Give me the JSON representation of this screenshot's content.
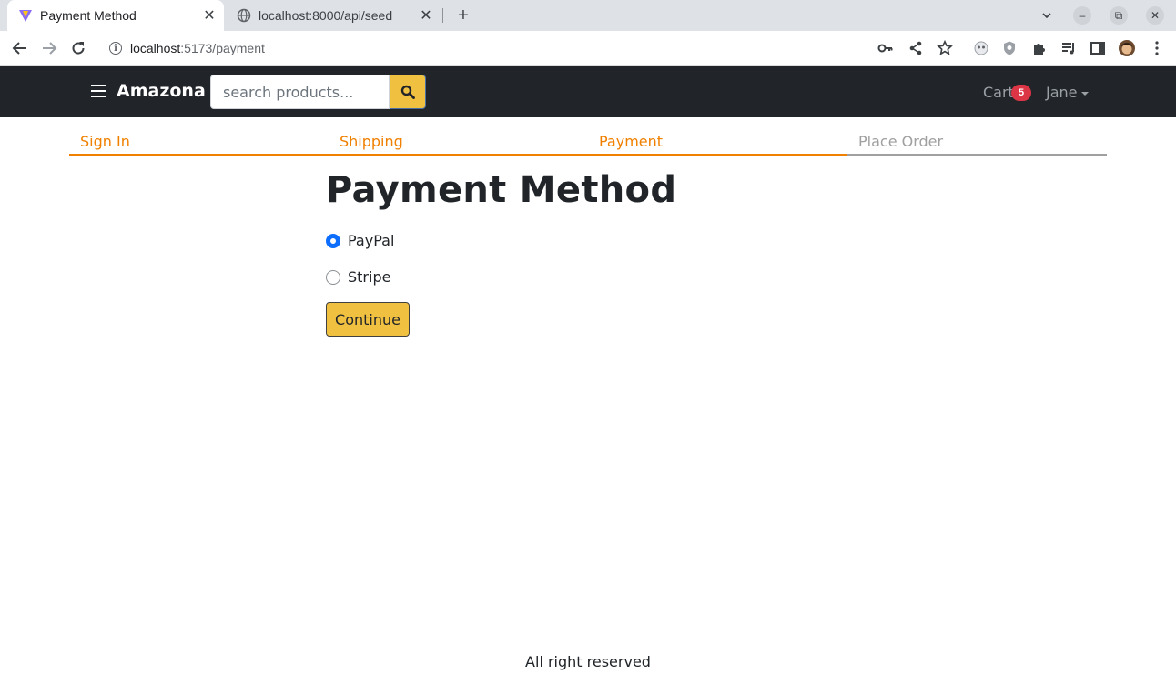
{
  "browser": {
    "tabs": [
      {
        "title": "Payment Method",
        "favicon": "vite-logo-icon"
      },
      {
        "title": "localhost:8000/api/seed",
        "favicon": "globe-icon"
      }
    ],
    "address": {
      "host": "localhost",
      "path": ":5173/payment"
    }
  },
  "navbar": {
    "brand": "Amazona",
    "search_placeholder": "search products...",
    "cart_label": "Cart",
    "cart_count": "5",
    "user_name": "Jane"
  },
  "steps": [
    "Sign In",
    "Shipping",
    "Payment",
    "Place Order"
  ],
  "form": {
    "title": "Payment Method",
    "options": [
      {
        "label": "PayPal",
        "checked": true
      },
      {
        "label": "Stripe",
        "checked": false
      }
    ],
    "submit_label": "Continue"
  },
  "footer": {
    "text": "All right reserved"
  },
  "colors": {
    "accent": "#f08000",
    "button": "#f0c040",
    "navbar": "#212529",
    "badge": "#dc3545",
    "radio": "#0d6efd"
  }
}
